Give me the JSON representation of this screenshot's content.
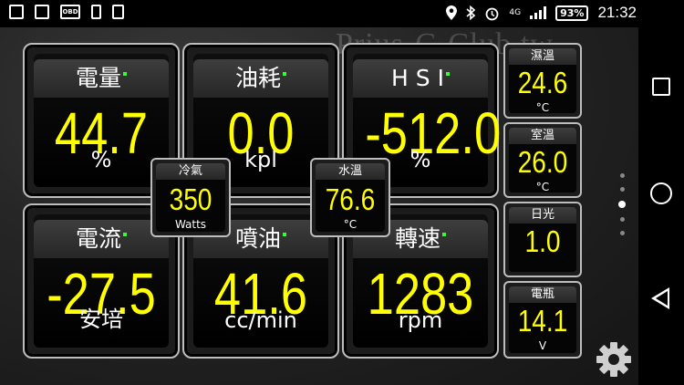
{
  "statusbar": {
    "left_icons": [
      "photo-icon",
      "image-icon",
      "obd-icon",
      "phone-icon",
      "tablet-icon"
    ],
    "obd_label": "OBD",
    "network": "4G",
    "battery": "93%",
    "clock": "21:32"
  },
  "watermark": "Prius-C-Club.tw",
  "main_gauges": [
    {
      "id": "charge",
      "label": "電量",
      "value": "44.7",
      "unit": "%"
    },
    {
      "id": "fuel-economy",
      "label": "油耗",
      "value": "0.0",
      "unit": "kpl"
    },
    {
      "id": "hsi",
      "label": "H S I",
      "value": "-512.0",
      "unit": "%"
    },
    {
      "id": "current",
      "label": "電流",
      "value": "-27.5",
      "unit": "安培"
    },
    {
      "id": "injection",
      "label": "噴油",
      "value": "41.6",
      "unit": "cc/min"
    },
    {
      "id": "rpm",
      "label": "轉速",
      "value": "1283",
      "unit": "rpm"
    }
  ],
  "overlay_gauges": [
    {
      "id": "ac",
      "label": "冷氣",
      "value": "350",
      "unit": "Watts"
    },
    {
      "id": "water-temp",
      "label": "水溫",
      "value": "76.6",
      "unit": "°C"
    }
  ],
  "side_gauges": [
    {
      "id": "intake-temp",
      "label": "濕溫",
      "value": "24.6",
      "unit": "°C"
    },
    {
      "id": "cabin-temp",
      "label": "室溫",
      "value": "26.0",
      "unit": "°C"
    },
    {
      "id": "sunlight",
      "label": "日光",
      "value": "1.0",
      "unit": ""
    },
    {
      "id": "battery-volt",
      "label": "電瓶",
      "value": "14.1",
      "unit": "V"
    }
  ],
  "colors": {
    "value": "#ffff00",
    "indicator": "#33ff33",
    "frame": "#bdbdbd"
  },
  "pager": {
    "count": 5,
    "active_index": 2
  },
  "navbar": [
    "recents-icon",
    "home-icon",
    "back-icon"
  ]
}
